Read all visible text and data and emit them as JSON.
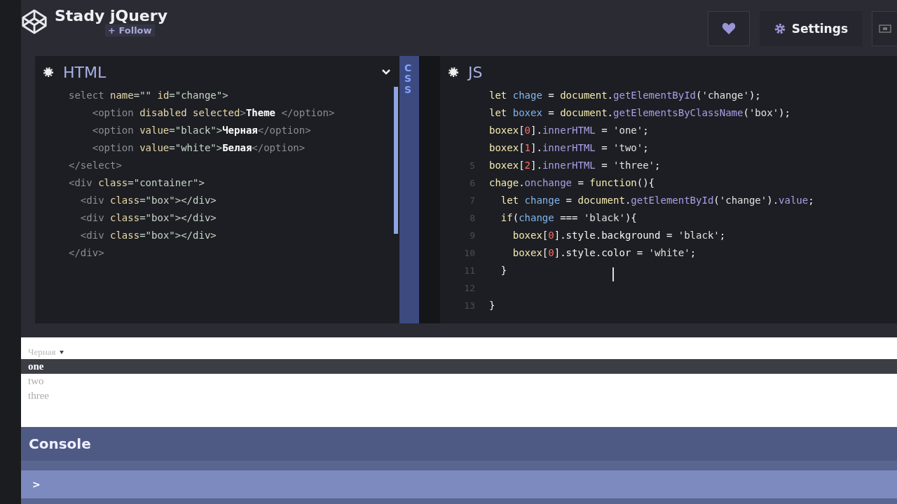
{
  "header": {
    "title": "Stady jQuery",
    "follow": "+ Follow",
    "settings": "Settings"
  },
  "html_panel": {
    "title": "HTML",
    "lines": [
      {
        "tokens": [
          {
            "t": "select ",
            "kind": "tag"
          },
          {
            "t": "name",
            "kind": "attr"
          },
          {
            "t": "=\"\" ",
            "kind": "str"
          },
          {
            "t": "id",
            "kind": "attr"
          },
          {
            "t": "=\"change\">",
            "kind": "str"
          }
        ]
      },
      {
        "tokens": [
          {
            "t": "    <option ",
            "kind": "tag"
          },
          {
            "t": "disabled selected",
            "kind": "attr"
          },
          {
            "t": ">",
            "kind": "tag"
          },
          {
            "t": "Theme ",
            "kind": "text"
          },
          {
            "t": "</option>",
            "kind": "tag"
          }
        ]
      },
      {
        "tokens": [
          {
            "t": "    <option ",
            "kind": "tag"
          },
          {
            "t": "value",
            "kind": "attr"
          },
          {
            "t": "=\"black\">",
            "kind": "str"
          },
          {
            "t": "Черная",
            "kind": "text"
          },
          {
            "t": "</option>",
            "kind": "tag"
          }
        ]
      },
      {
        "tokens": [
          {
            "t": "    <option ",
            "kind": "tag"
          },
          {
            "t": "value",
            "kind": "attr"
          },
          {
            "t": "=\"white\">",
            "kind": "str"
          },
          {
            "t": "Белая",
            "kind": "text"
          },
          {
            "t": "</option>",
            "kind": "tag"
          }
        ]
      },
      {
        "tokens": [
          {
            "t": "</select>",
            "kind": "tag"
          }
        ]
      },
      {
        "tokens": [
          {
            "t": "<div ",
            "kind": "tag"
          },
          {
            "t": "class",
            "kind": "attr"
          },
          {
            "t": "=\"container\">",
            "kind": "str"
          }
        ]
      },
      {
        "tokens": [
          {
            "t": "  <div ",
            "kind": "tag"
          },
          {
            "t": "class",
            "kind": "attr"
          },
          {
            "t": "=\"box\"></div>",
            "kind": "str"
          }
        ]
      },
      {
        "tokens": [
          {
            "t": "  <div ",
            "kind": "tag"
          },
          {
            "t": "class",
            "kind": "attr"
          },
          {
            "t": "=\"box\"></div>",
            "kind": "str"
          }
        ]
      },
      {
        "tokens": [
          {
            "t": "  <div ",
            "kind": "tag"
          },
          {
            "t": "class",
            "kind": "attr"
          },
          {
            "t": "=\"box\"></div>",
            "kind": "str"
          }
        ]
      },
      {
        "tokens": [
          {
            "t": "</div>",
            "kind": "tag"
          }
        ]
      }
    ]
  },
  "css_tab": {
    "label": "CSS"
  },
  "js_panel": {
    "title": "JS",
    "lines": [
      {
        "tokens": [
          {
            "t": "let ",
            "kind": "kw"
          },
          {
            "t": "chage",
            "kind": "var"
          },
          {
            "t": " = ",
            "kind": "punc"
          },
          {
            "t": "document",
            "kind": "kw"
          },
          {
            "t": ".",
            "kind": "punc"
          },
          {
            "t": "getElementById",
            "kind": "fn"
          },
          {
            "t": "(",
            "kind": "punc"
          },
          {
            "t": "'change'",
            "kind": "str"
          },
          {
            "t": ");",
            "kind": "punc"
          }
        ]
      },
      {
        "tokens": [
          {
            "t": "let ",
            "kind": "kw"
          },
          {
            "t": "boxex",
            "kind": "var"
          },
          {
            "t": " = ",
            "kind": "punc"
          },
          {
            "t": "document",
            "kind": "kw"
          },
          {
            "t": ".",
            "kind": "punc"
          },
          {
            "t": "getElementsByClassName",
            "kind": "fn"
          },
          {
            "t": "(",
            "kind": "punc"
          },
          {
            "t": "'box'",
            "kind": "str"
          },
          {
            "t": ");",
            "kind": "punc"
          }
        ]
      },
      {
        "tokens": [
          {
            "t": "boxex",
            "kind": "kw"
          },
          {
            "t": "[",
            "kind": "punc"
          },
          {
            "t": "0",
            "kind": "num"
          },
          {
            "t": "].",
            "kind": "punc"
          },
          {
            "t": "innerHTML",
            "kind": "fn"
          },
          {
            "t": " = ",
            "kind": "punc"
          },
          {
            "t": "'one'",
            "kind": "str"
          },
          {
            "t": ";",
            "kind": "punc"
          }
        ]
      },
      {
        "tokens": [
          {
            "t": "boxex",
            "kind": "kw"
          },
          {
            "t": "[",
            "kind": "punc"
          },
          {
            "t": "1",
            "kind": "num"
          },
          {
            "t": "].",
            "kind": "punc"
          },
          {
            "t": "innerHTML",
            "kind": "fn"
          },
          {
            "t": " = ",
            "kind": "punc"
          },
          {
            "t": "'two'",
            "kind": "str"
          },
          {
            "t": ";",
            "kind": "punc"
          }
        ]
      },
      {
        "number": "5",
        "tokens": [
          {
            "t": "boxex",
            "kind": "kw"
          },
          {
            "t": "[",
            "kind": "punc"
          },
          {
            "t": "2",
            "kind": "num"
          },
          {
            "t": "].",
            "kind": "punc"
          },
          {
            "t": "innerHTML",
            "kind": "fn"
          },
          {
            "t": " = ",
            "kind": "punc"
          },
          {
            "t": "'three'",
            "kind": "str"
          },
          {
            "t": ";",
            "kind": "punc"
          }
        ]
      },
      {
        "number": "6",
        "tokens": [
          {
            "t": "chage",
            "kind": "kw"
          },
          {
            "t": ".",
            "kind": "punc"
          },
          {
            "t": "onchange",
            "kind": "fn"
          },
          {
            "t": " = ",
            "kind": "punc"
          },
          {
            "t": "function",
            "kind": "kw"
          },
          {
            "t": "(){",
            "kind": "punc"
          }
        ]
      },
      {
        "number": "7",
        "tokens": [
          {
            "t": "  let ",
            "kind": "kw"
          },
          {
            "t": "change",
            "kind": "var"
          },
          {
            "t": " = ",
            "kind": "punc"
          },
          {
            "t": "document",
            "kind": "kw"
          },
          {
            "t": ".",
            "kind": "punc"
          },
          {
            "t": "getElementById",
            "kind": "fn"
          },
          {
            "t": "(",
            "kind": "punc"
          },
          {
            "t": "'change'",
            "kind": "str"
          },
          {
            "t": ").",
            "kind": "punc"
          },
          {
            "t": "value",
            "kind": "fn"
          },
          {
            "t": ";",
            "kind": "punc"
          }
        ]
      },
      {
        "number": "8",
        "tokens": [
          {
            "t": "  if",
            "kind": "kw"
          },
          {
            "t": "(",
            "kind": "punc"
          },
          {
            "t": "change",
            "kind": "var"
          },
          {
            "t": " === ",
            "kind": "punc"
          },
          {
            "t": "'black'",
            "kind": "str"
          },
          {
            "t": "){",
            "kind": "punc"
          }
        ]
      },
      {
        "number": "9",
        "tokens": [
          {
            "t": "    boxex",
            "kind": "kw"
          },
          {
            "t": "[",
            "kind": "punc"
          },
          {
            "t": "0",
            "kind": "num"
          },
          {
            "t": "].style.background",
            "kind": "punc"
          },
          {
            "t": " = ",
            "kind": "punc"
          },
          {
            "t": "'black'",
            "kind": "str"
          },
          {
            "t": ";",
            "kind": "punc"
          }
        ]
      },
      {
        "number": "10",
        "tokens": [
          {
            "t": "    boxex",
            "kind": "kw"
          },
          {
            "t": "[",
            "kind": "punc"
          },
          {
            "t": "0",
            "kind": "num"
          },
          {
            "t": "].style.color",
            "kind": "punc"
          },
          {
            "t": " = ",
            "kind": "punc"
          },
          {
            "t": "'white'",
            "kind": "str"
          },
          {
            "t": ";",
            "kind": "punc"
          }
        ]
      },
      {
        "number": "11",
        "tokens": [
          {
            "t": "  }",
            "kind": "punc"
          }
        ]
      },
      {
        "number": "12"
      },
      {
        "number": "13",
        "tokens": [
          {
            "t": "}",
            "kind": "punc"
          }
        ]
      }
    ]
  },
  "preview": {
    "select_value": "Черная",
    "boxes": [
      {
        "text": "one",
        "dark": true
      },
      {
        "text": "two",
        "dark": false
      },
      {
        "text": "three",
        "dark": false
      }
    ]
  },
  "console": {
    "title": "Console",
    "prompt": ">"
  }
}
